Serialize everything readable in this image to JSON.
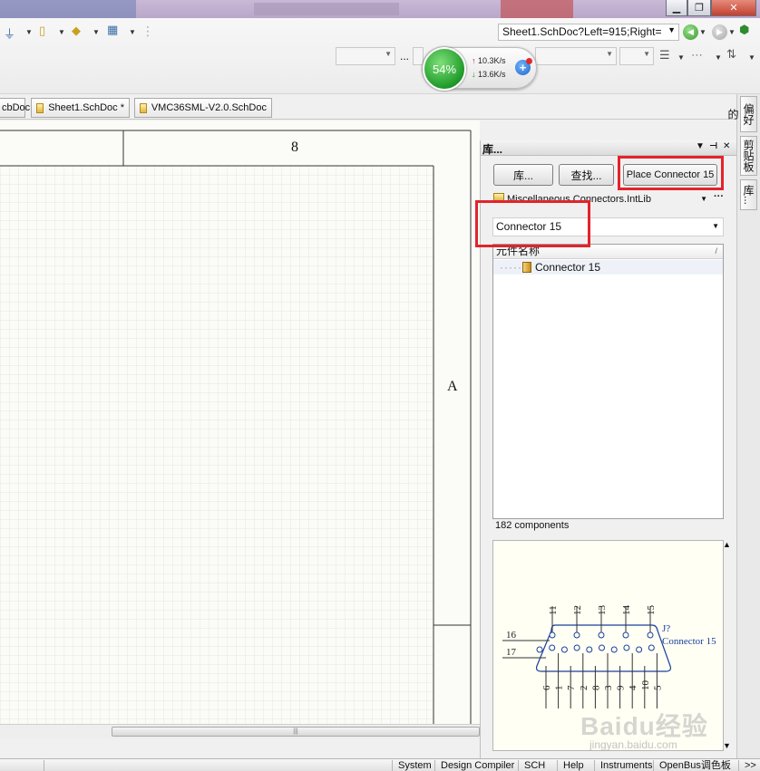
{
  "toolbar": {
    "sheet_nav": "Sheet1.SchDoc?Left=915;Right=",
    "ellipsis": "...",
    "network": {
      "percent": "54%",
      "upload": "10.3K/s",
      "download": "13.6K/s"
    }
  },
  "tabs": [
    {
      "label": "cbDoc"
    },
    {
      "label": "Sheet1.SchDoc *"
    },
    {
      "label": "VMC36SML-V2.0.SchDoc"
    }
  ],
  "canvas": {
    "column_label": "8",
    "row_label": "A"
  },
  "library_panel": {
    "title": "库...",
    "libraries_button": "库...",
    "search_button": "查找...",
    "place_button": "Place Connector 15",
    "library_name": "Miscellaneous Connectors.IntLib",
    "filter_value": "Connector 15",
    "column_header": "元件名称",
    "component_row": "Connector 15",
    "component_count": "182 components",
    "preview": {
      "designator": "J?",
      "comment": "Connector 15",
      "top_pins": [
        "11",
        "12",
        "13",
        "14",
        "15"
      ],
      "side_pins": [
        "16",
        "17"
      ],
      "bottom_pins": [
        "6",
        "1",
        "7",
        "2",
        "8",
        "3",
        "9",
        "4",
        "10",
        "5"
      ]
    }
  },
  "right_strip": {
    "tabs": [
      "偏好的",
      "剪贴板",
      "库..."
    ]
  },
  "statusbar": {
    "items": [
      "System",
      "Design Compiler",
      "SCH",
      "Help",
      "Instruments",
      "OpenBus调色板"
    ],
    "more": ">>"
  },
  "watermark": {
    "logo": "Baidu经验",
    "url": "jingyan.baidu.com"
  },
  "colors": {
    "highlight": "#e3232c",
    "grid": "#e6e6e6",
    "pin_blue": "#1a3f9c"
  }
}
